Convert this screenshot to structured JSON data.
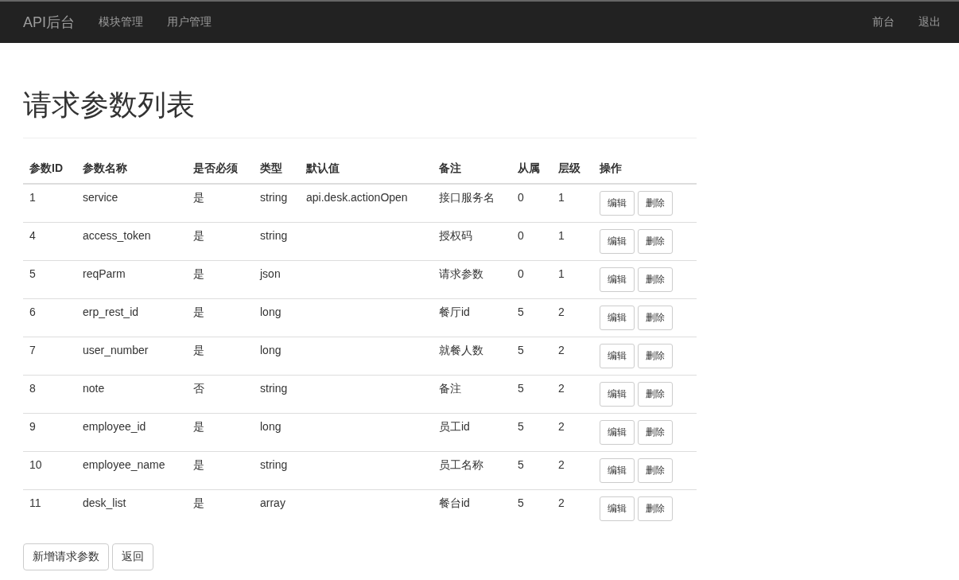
{
  "navbar": {
    "brand": "API后台",
    "links": [
      "模块管理",
      "用户管理"
    ],
    "right_links": [
      "前台",
      "退出"
    ]
  },
  "page_title": "请求参数列表",
  "table": {
    "columns": [
      "参数ID",
      "参数名称",
      "是否必须",
      "类型",
      "默认值",
      "备注",
      "从属",
      "层级",
      "操作"
    ],
    "rows": [
      {
        "id": "1",
        "name": "service",
        "required": "是",
        "type": "string",
        "default": "api.desk.actionOpen",
        "note": "接口服务名",
        "parent": "0",
        "level_no": "1",
        "actions": [
          "编辑",
          "删除"
        ]
      },
      {
        "id": "4",
        "name": "access_token",
        "required": "是",
        "type": "string",
        "default": "",
        "note": "授权码",
        "parent": "0",
        "level_no": "1",
        "actions": [
          "编辑",
          "删除"
        ]
      },
      {
        "id": "5",
        "name": "reqParm",
        "required": "是",
        "type": "json",
        "default": "",
        "note": "请求参数",
        "parent": "0",
        "level_no": "1",
        "actions": [
          "编辑",
          "删除"
        ]
      },
      {
        "id": "6",
        "name": "erp_rest_id",
        "required": "是",
        "type": "long",
        "default": "",
        "note": "餐厅id",
        "parent": "5",
        "level_no": "2",
        "actions": [
          "编辑",
          "删除"
        ]
      },
      {
        "id": "7",
        "name": "user_number",
        "required": "是",
        "type": "long",
        "default": "",
        "note": "就餐人数",
        "parent": "5",
        "level_no": "2",
        "actions": [
          "编辑",
          "删除"
        ]
      },
      {
        "id": "8",
        "name": "note",
        "required": "否",
        "type": "string",
        "default": "",
        "note": "备注",
        "parent": "5",
        "level_no": "2",
        "actions": [
          "编辑",
          "删除"
        ]
      },
      {
        "id": "9",
        "name": "employee_id",
        "required": "是",
        "type": "long",
        "default": "",
        "note": "员工id",
        "parent": "5",
        "level_no": "2",
        "actions": [
          "编辑",
          "删除"
        ]
      },
      {
        "id": "10",
        "name": "employee_name",
        "required": "是",
        "type": "string",
        "default": "",
        "note": "员工名称",
        "parent": "5",
        "level_no": "2",
        "actions": [
          "编辑",
          "删除"
        ]
      },
      {
        "id": "11",
        "name": "desk_list",
        "required": "是",
        "type": "array",
        "default": "",
        "note": "餐台id",
        "parent": "5",
        "level_no": "2",
        "actions": [
          "编辑",
          "删除"
        ]
      }
    ]
  },
  "buttons": [
    "新增请求参数",
    "返回"
  ]
}
